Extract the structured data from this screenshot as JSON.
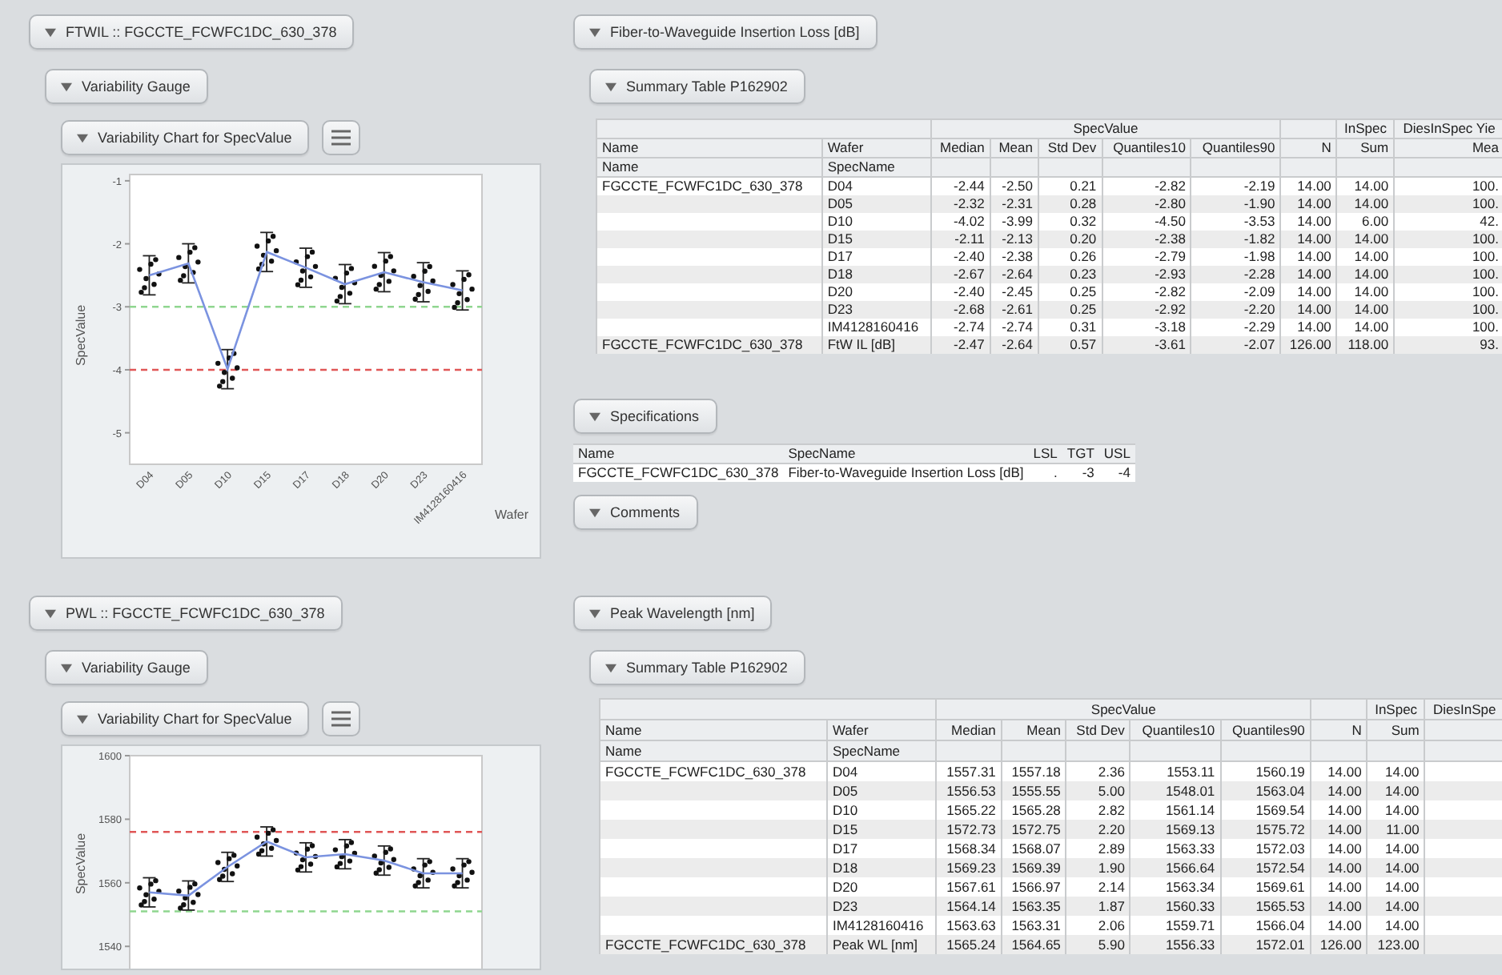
{
  "sections": [
    {
      "outline": {
        "title": "FTWIL :: FGCCTE_FCWFC1DC_630_378",
        "expanded": true
      },
      "gauge": {
        "title": "Variability Gauge",
        "expanded": true
      },
      "chart_panel": {
        "title": "Variability Chart for SpecValue",
        "expanded": true,
        "chart_data": {
          "type": "line",
          "xlabel": "Wafer",
          "ylabel": "SpecValue",
          "categories": [
            "D04",
            "D05",
            "D10",
            "D15",
            "D17",
            "D18",
            "D20",
            "D23",
            "IM4128160416"
          ],
          "series": [
            {
              "color": "#7b93e0",
              "values": [
                -2.5,
                -2.31,
                -3.99,
                -2.13,
                -2.38,
                -2.64,
                -2.45,
                -2.61,
                -2.74
              ]
            }
          ],
          "ylim": [
            -5.5,
            -0.9
          ],
          "yticks": [
            {
              "value": -1,
              "label": "-1"
            },
            {
              "value": -2,
              "label": "-2"
            },
            {
              "value": -3,
              "label": "-3"
            },
            {
              "value": -4,
              "label": "-4"
            },
            {
              "value": -5,
              "label": "-5"
            }
          ],
          "ref_lines": [
            {
              "axis": "y",
              "value": -3,
              "color": "#8fd68f"
            },
            {
              "axis": "y",
              "value": -4,
              "color": "#e05656"
            }
          ]
        }
      },
      "report": {
        "title": "Fiber-to-Waveguide Insertion Loss [dB]",
        "expanded": true
      },
      "summary": {
        "title": "Summary Table P162902",
        "expanded": true,
        "header_rows": [
          [
            {
              "text": ""
            },
            {
              "text": "SpecValue"
            },
            {
              "text": ""
            },
            {
              "text": "InSpec"
            },
            {
              "text": "DiesInSpec Yie"
            }
          ],
          [
            {
              "text": "Name"
            },
            {
              "text": "Wafer"
            },
            {
              "text": "Median"
            },
            {
              "text": "Mean"
            },
            {
              "text": "Std Dev"
            },
            {
              "text": "Quantiles10"
            },
            {
              "text": "Quantiles90"
            },
            {
              "text": "N"
            },
            {
              "text": "Sum"
            },
            {
              "text": "Mea"
            }
          ],
          [
            {
              "text": "Name"
            },
            {
              "text": "SpecName"
            },
            {
              "text": ""
            },
            {
              "text": ""
            },
            {
              "text": ""
            },
            {
              "text": ""
            },
            {
              "text": ""
            },
            {
              "text": ""
            },
            {
              "text": ""
            },
            {
              "text": ""
            }
          ]
        ],
        "rows": [
          [
            "FGCCTE_FCWFC1DC_630_378",
            "D04",
            "-2.44",
            "-2.50",
            "0.21",
            "-2.82",
            "-2.19",
            "14.00",
            "14.00",
            "100."
          ],
          [
            "",
            "D05",
            "-2.32",
            "-2.31",
            "0.28",
            "-2.80",
            "-1.90",
            "14.00",
            "14.00",
            "100."
          ],
          [
            "",
            "D10",
            "-4.02",
            "-3.99",
            "0.32",
            "-4.50",
            "-3.53",
            "14.00",
            "6.00",
            "42."
          ],
          [
            "",
            "D15",
            "-2.11",
            "-2.13",
            "0.20",
            "-2.38",
            "-1.82",
            "14.00",
            "14.00",
            "100."
          ],
          [
            "",
            "D17",
            "-2.40",
            "-2.38",
            "0.26",
            "-2.79",
            "-1.98",
            "14.00",
            "14.00",
            "100."
          ],
          [
            "",
            "D18",
            "-2.67",
            "-2.64",
            "0.23",
            "-2.93",
            "-2.28",
            "14.00",
            "14.00",
            "100."
          ],
          [
            "",
            "D20",
            "-2.40",
            "-2.45",
            "0.25",
            "-2.82",
            "-2.09",
            "14.00",
            "14.00",
            "100."
          ],
          [
            "",
            "D23",
            "-2.68",
            "-2.61",
            "0.25",
            "-2.92",
            "-2.20",
            "14.00",
            "14.00",
            "100."
          ],
          [
            "",
            "IM4128160416",
            "-2.74",
            "-2.74",
            "0.31",
            "-3.18",
            "-2.29",
            "14.00",
            "14.00",
            "100."
          ],
          [
            "FGCCTE_FCWFC1DC_630_378",
            "FtW IL [dB]",
            "-2.47",
            "-2.64",
            "0.57",
            "-3.61",
            "-2.07",
            "126.00",
            "118.00",
            "93."
          ]
        ]
      },
      "specifications": {
        "title": "Specifications",
        "expanded": true,
        "columns": [
          "Name",
          "SpecName",
          "LSL",
          "TGT",
          "USL"
        ],
        "rows": [
          [
            "FGCCTE_FCWFC1DC_630_378",
            "Fiber-to-Waveguide Insertion Loss [dB]",
            ".",
            "-3",
            "-4"
          ]
        ]
      },
      "comments": {
        "title": "Comments",
        "expanded": true
      }
    },
    {
      "outline": {
        "title": "PWL :: FGCCTE_FCWFC1DC_630_378",
        "expanded": true
      },
      "gauge": {
        "title": "Variability Gauge",
        "expanded": true
      },
      "chart_panel": {
        "title": "Variability Chart for SpecValue",
        "expanded": true,
        "chart_data": {
          "type": "line",
          "ylabel": "SpecValue",
          "series": [
            {
              "color": "#7b93e0",
              "values": [
                1557,
                1556,
                1565,
                1573,
                1568,
                1569,
                1567,
                1563,
                1563
              ]
            }
          ],
          "ylim": [
            1532,
            1600
          ],
          "yticks": [
            {
              "value": 1540,
              "label": "1540"
            },
            {
              "value": 1560,
              "label": "1560"
            },
            {
              "value": 1580,
              "label": "1580"
            },
            {
              "value": 1600,
              "label": "1600"
            }
          ],
          "ref_lines": [
            {
              "axis": "y",
              "value": 1576,
              "color": "#e05656"
            },
            {
              "axis": "y",
              "value": 1551,
              "color": "#8fd68f"
            }
          ]
        }
      },
      "report": {
        "title": "Peak Wavelength [nm]",
        "expanded": true
      },
      "summary": {
        "title": "Summary Table P162902",
        "expanded": true,
        "header_rows": [
          [
            {
              "text": ""
            },
            {
              "text": "SpecValue"
            },
            {
              "text": ""
            },
            {
              "text": "InSpec"
            },
            {
              "text": "DiesInSpe"
            }
          ],
          [
            {
              "text": "Name"
            },
            {
              "text": "Wafer"
            },
            {
              "text": "Median"
            },
            {
              "text": "Mean"
            },
            {
              "text": "Std Dev"
            },
            {
              "text": "Quantiles10"
            },
            {
              "text": "Quantiles90"
            },
            {
              "text": "N"
            },
            {
              "text": "Sum"
            },
            {
              "text": ""
            }
          ],
          [
            {
              "text": "Name"
            },
            {
              "text": "SpecName"
            },
            {
              "text": ""
            },
            {
              "text": ""
            },
            {
              "text": ""
            },
            {
              "text": ""
            },
            {
              "text": ""
            },
            {
              "text": ""
            },
            {
              "text": ""
            },
            {
              "text": ""
            }
          ]
        ],
        "rows": [
          [
            "FGCCTE_FCWFC1DC_630_378",
            "D04",
            "1557.31",
            "1557.18",
            "2.36",
            "1553.11",
            "1560.19",
            "14.00",
            "14.00",
            ""
          ],
          [
            "",
            "D05",
            "1556.53",
            "1555.55",
            "5.00",
            "1548.01",
            "1563.04",
            "14.00",
            "14.00",
            ""
          ],
          [
            "",
            "D10",
            "1565.22",
            "1565.28",
            "2.82",
            "1561.14",
            "1569.54",
            "14.00",
            "14.00",
            ""
          ],
          [
            "",
            "D15",
            "1572.73",
            "1572.75",
            "2.20",
            "1569.13",
            "1575.72",
            "14.00",
            "11.00",
            ""
          ],
          [
            "",
            "D17",
            "1568.34",
            "1568.07",
            "2.89",
            "1563.33",
            "1572.03",
            "14.00",
            "14.00",
            ""
          ],
          [
            "",
            "D18",
            "1569.23",
            "1569.39",
            "1.90",
            "1566.64",
            "1572.54",
            "14.00",
            "14.00",
            ""
          ],
          [
            "",
            "D20",
            "1567.61",
            "1566.97",
            "2.14",
            "1563.34",
            "1569.61",
            "14.00",
            "14.00",
            ""
          ],
          [
            "",
            "D23",
            "1564.14",
            "1563.35",
            "1.87",
            "1560.33",
            "1565.53",
            "14.00",
            "14.00",
            ""
          ],
          [
            "",
            "IM4128160416",
            "1563.63",
            "1563.31",
            "2.06",
            "1559.71",
            "1566.04",
            "14.00",
            "14.00",
            ""
          ],
          [
            "FGCCTE_FCWFC1DC_630_378",
            "Peak WL [nm]",
            "1565.24",
            "1564.65",
            "5.90",
            "1556.33",
            "1572.01",
            "126.00",
            "123.00",
            ""
          ]
        ]
      }
    }
  ]
}
